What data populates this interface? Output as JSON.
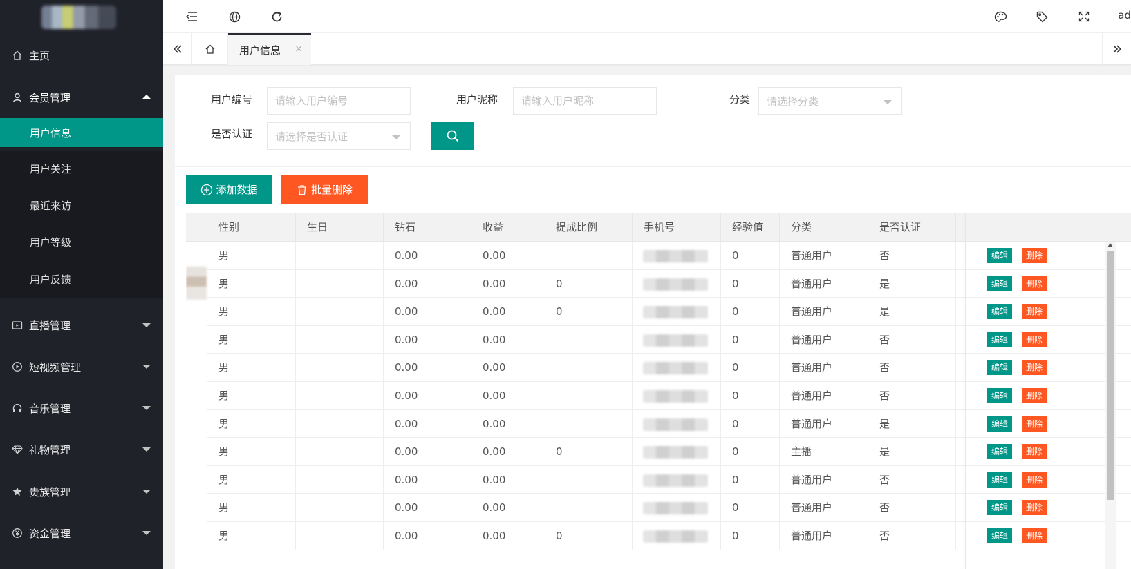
{
  "header": {
    "admin_label": "ad",
    "icons": [
      "menu-collapse-icon",
      "globe-icon",
      "refresh-icon",
      "palette-icon",
      "tag-icon",
      "fullscreen-icon"
    ]
  },
  "sidebar": {
    "home": "主页",
    "member": "会员管理",
    "member_items": [
      "用户信息",
      "用户关注",
      "最近来访",
      "用户等级",
      "用户反馈"
    ],
    "live": "直播管理",
    "video": "短视频管理",
    "music": "音乐管理",
    "gift": "礼物管理",
    "noble": "贵族管理",
    "fund": "资金管理"
  },
  "tabs": {
    "active": "用户信息",
    "close": "×"
  },
  "filters": {
    "user_id_label": "用户编号",
    "user_id_placeholder": "请输入用户编号",
    "nickname_label": "用户昵称",
    "nickname_placeholder": "请输入用户昵称",
    "category_label": "分类",
    "category_placeholder": "请选择分类",
    "verified_label": "是否认证",
    "verified_placeholder": "请选择是否认证"
  },
  "toolbar": {
    "add_label": "添加数据",
    "batch_delete_label": "批量删除"
  },
  "table": {
    "columns": [
      "性别",
      "生日",
      "钻石",
      "收益",
      "提成比例",
      "手机号",
      "经验值",
      "分类",
      "是否认证"
    ],
    "edit_label": "编辑",
    "delete_label": "删除",
    "rows": [
      {
        "gender": "男",
        "birthday": "",
        "diamond": "0.00",
        "income": "0.00",
        "commission": "",
        "exp": "0",
        "category": "普通用户",
        "verified": "否"
      },
      {
        "gender": "男",
        "birthday": "",
        "diamond": "0.00",
        "income": "0.00",
        "commission": "0",
        "exp": "0",
        "category": "普通用户",
        "verified": "是"
      },
      {
        "gender": "男",
        "birthday": "",
        "diamond": "0.00",
        "income": "0.00",
        "commission": "0",
        "exp": "0",
        "category": "普通用户",
        "verified": "是"
      },
      {
        "gender": "男",
        "birthday": "",
        "diamond": "0.00",
        "income": "0.00",
        "commission": "",
        "exp": "0",
        "category": "普通用户",
        "verified": "否"
      },
      {
        "gender": "男",
        "birthday": "",
        "diamond": "0.00",
        "income": "0.00",
        "commission": "",
        "exp": "0",
        "category": "普通用户",
        "verified": "否"
      },
      {
        "gender": "男",
        "birthday": "",
        "diamond": "0.00",
        "income": "0.00",
        "commission": "",
        "exp": "0",
        "category": "普通用户",
        "verified": "否"
      },
      {
        "gender": "男",
        "birthday": "",
        "diamond": "0.00",
        "income": "0.00",
        "commission": "",
        "exp": "0",
        "category": "普通用户",
        "verified": "是"
      },
      {
        "gender": "男",
        "birthday": "",
        "diamond": "0.00",
        "income": "0.00",
        "commission": "0",
        "exp": "0",
        "category": "主播",
        "verified": "是"
      },
      {
        "gender": "男",
        "birthday": "",
        "diamond": "0.00",
        "income": "0.00",
        "commission": "",
        "exp": "0",
        "category": "普通用户",
        "verified": "否"
      },
      {
        "gender": "男",
        "birthday": "",
        "diamond": "0.00",
        "income": "0.00",
        "commission": "",
        "exp": "0",
        "category": "普通用户",
        "verified": "否"
      },
      {
        "gender": "男",
        "birthday": "",
        "diamond": "0.00",
        "income": "0.00",
        "commission": "0",
        "exp": "0",
        "category": "普通用户",
        "verified": "否"
      }
    ]
  },
  "colors": {
    "primary": "#009688",
    "danger": "#ff5722",
    "sidebar_bg": "#20222a"
  }
}
